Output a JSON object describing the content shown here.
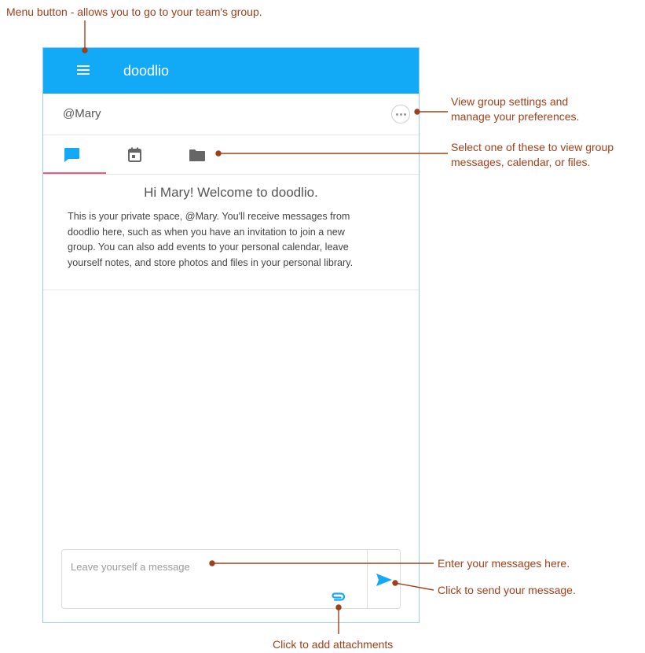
{
  "app": {
    "title": "doodlio",
    "group_name": "@Mary",
    "accent_color": "#12a9f6",
    "tab_indicator_color": "#f05a7e"
  },
  "tabs": [
    {
      "icon": "chat-bubble-icon",
      "active": true
    },
    {
      "icon": "calendar-icon",
      "active": false
    },
    {
      "icon": "folder-icon",
      "active": false
    }
  ],
  "welcome": {
    "title": "Hi Mary! Welcome to doodlio.",
    "lines": [
      "This is your private space, @Mary. You'll receive messages from",
      "doodlio here, such as when you have an invitation to join a new",
      "group. You can also add events to your personal calendar, leave",
      "yourself notes, and store photos and files in your personal library."
    ]
  },
  "composer": {
    "placeholder": "Leave yourself a message",
    "send_icon": "send-icon",
    "attach_icon": "paperclip-icon"
  },
  "annotations": {
    "menu": "Menu button - allows you to go to your team's group.",
    "settings_line1": "View group settings and",
    "settings_line2": "manage your preferences.",
    "tabs_line1": "Select one of these to view group",
    "tabs_line2": "messages, calendar, or files.",
    "enter": "Enter your messages here.",
    "send": "Click to send your message.",
    "attach": "Click to add attachments",
    "color": "#a0401a"
  }
}
